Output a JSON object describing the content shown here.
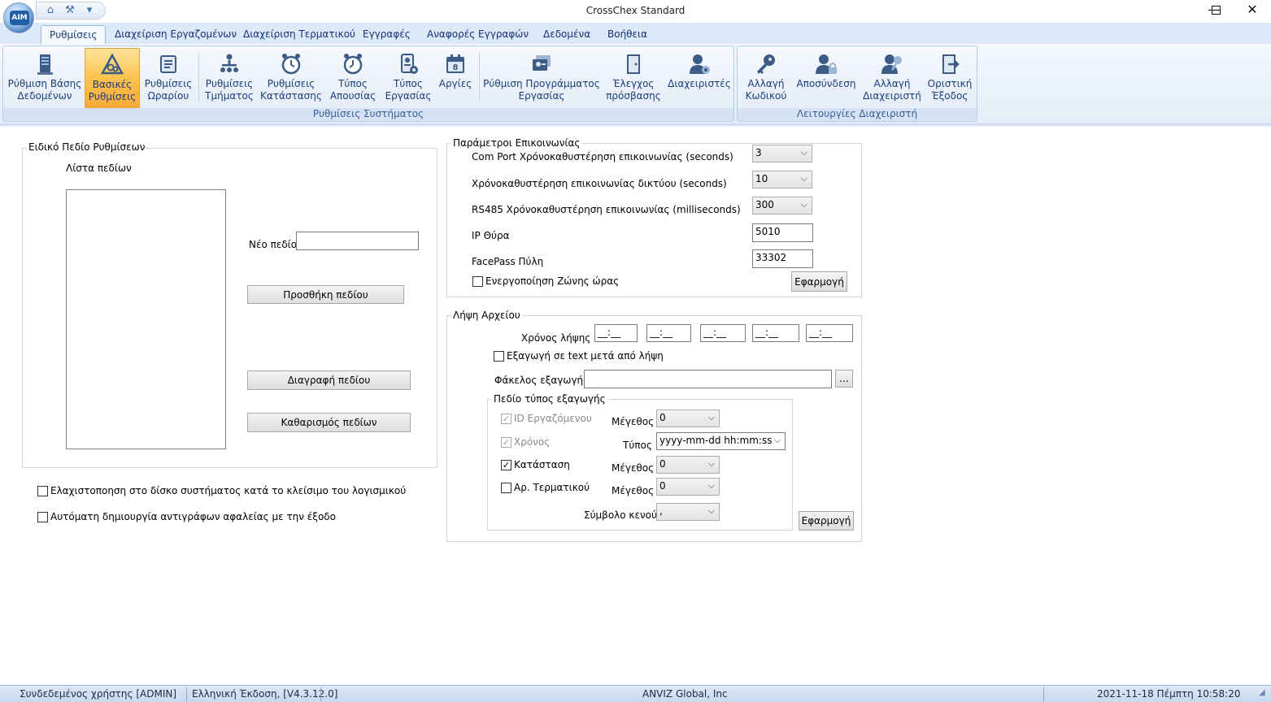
{
  "window": {
    "title": "CrossChex Standard",
    "logo_text": "AIM"
  },
  "tabs": [
    {
      "label": "Ρυθμίσεις"
    },
    {
      "label": "Διαχείριση Εργαζομένων"
    },
    {
      "label": "Διαχείριση Τερματικού"
    },
    {
      "label": "Εγγραφές"
    },
    {
      "label": "Αναφορές Εγγραφών"
    },
    {
      "label": "Δεδομένα"
    },
    {
      "label": "Βοήθεια"
    }
  ],
  "ribbon": {
    "system_group_label": "Ρυθμίσεις Συστήματος",
    "admin_group_label": "Λειτουργίες Διαχειριστή",
    "buttons": [
      {
        "line1": "Ρύθμιση Βάσης",
        "line2": "Δεδομένων"
      },
      {
        "line1": "Βασικές",
        "line2": "Ρυθμίσεις"
      },
      {
        "line1": "Ρυθμίσεις",
        "line2": "Ωραρίου"
      },
      {
        "line1": "Ρυθμίσεις",
        "line2": "Τμήματος"
      },
      {
        "line1": "Ρυθμίσεις",
        "line2": "Κατάστασης"
      },
      {
        "line1": "Τύπος",
        "line2": "Απουσίας"
      },
      {
        "line1": "Τύπος",
        "line2": "Εργασίας"
      },
      {
        "line1": "Αργίες",
        "line2": ""
      },
      {
        "line1": "Ρύθμιση Προγράμματος",
        "line2": "Εργασίας"
      },
      {
        "line1": "Έλεγχος",
        "line2": "πρόσβασης"
      },
      {
        "line1": "Διαχειριστές",
        "line2": ""
      },
      {
        "line1": "Αλλαγή",
        "line2": "Κωδικού"
      },
      {
        "line1": "Αποσύνδεση",
        "line2": ""
      },
      {
        "line1": "Αλλαγή",
        "line2": "Διαχειριστή"
      },
      {
        "line1": "Οριστική",
        "line2": "Έξοδος"
      }
    ]
  },
  "custom_fields": {
    "legend": "Ειδικό Πεδίο Ρυθμίσεων",
    "list_label": "Λίστα πεδίων",
    "new_field_label": "Νέο πεδίο",
    "new_field_value": "",
    "add_button": "Προσθήκη πεδίου",
    "delete_button": "Διαγραφή πεδίου",
    "clear_button": "Καθαρισμός πεδίων"
  },
  "options": {
    "minimize_tray": "Ελαχιστοποηση στο δίσκο συστήματος κατά το κλείσιμο του λογισμικού",
    "auto_backup": "Αυτόματη δημιουργία αντιγράφων αφαλείας με την έξοδο"
  },
  "comm": {
    "legend": "Παράμετροι Επικοινωνίας",
    "com_port_label": "Com Port Χρόνοκαθυστέρηση επικοινωνίας (seconds)",
    "com_port_value": "3",
    "network_label": "Χρόνοκαθυστέρηση επικοινωνίας δικτύου (seconds)",
    "network_value": "10",
    "rs485_label": "RS485 Χρόνοκαθυστέρηση επικοινωνίας (milliseconds)",
    "rs485_value": "300",
    "ip_port_label": "IP Θύρα",
    "ip_port_value": "5010",
    "facepass_label": "FacePass Πύλη",
    "facepass_value": "33302",
    "timezone_label": "Ενεργοποίηση Ζώνης ώρας",
    "apply_button": "Εφαρμογή"
  },
  "download": {
    "legend": "Λήψη Αρχείου",
    "time_label": "Χρόνος λήψης",
    "times": [
      "__:__",
      "__:__",
      "__:__",
      "__:__",
      "__:__"
    ],
    "export_text_label": "Εξαγωγή σε text μετά από λήψη",
    "folder_label": "Φάκελος εξαγωγής",
    "folder_value": "",
    "browse_button": "...",
    "export_fields": {
      "legend": "Πεδίο τύπος εξαγωγής",
      "employee_id_label": "ID Εργαζόμενου",
      "size_label": "Μέγεθος",
      "employee_id_size": "0",
      "time_label": "Χρόνος",
      "type_label": "Τύπος",
      "time_format": "yyyy-mm-dd hh:mm:ss",
      "status_label": "Κατάσταση",
      "status_size": "0",
      "terminal_label": "Αρ. Τερματικού",
      "terminal_size": "0",
      "blank_symbol_label": "Σύμβολο κενού",
      "blank_symbol_value": ","
    },
    "apply_button": "Εφαρμογή"
  },
  "status_bar": {
    "user": "Συνδεδεμένος χρήστης [ADMIN]",
    "version": "Ελληνική Έκδοση, [V4.3.12.0]",
    "company": "ANVIZ Global, Inc",
    "datetime": "2021-11-18 Πέμπτη 10:58:20"
  }
}
